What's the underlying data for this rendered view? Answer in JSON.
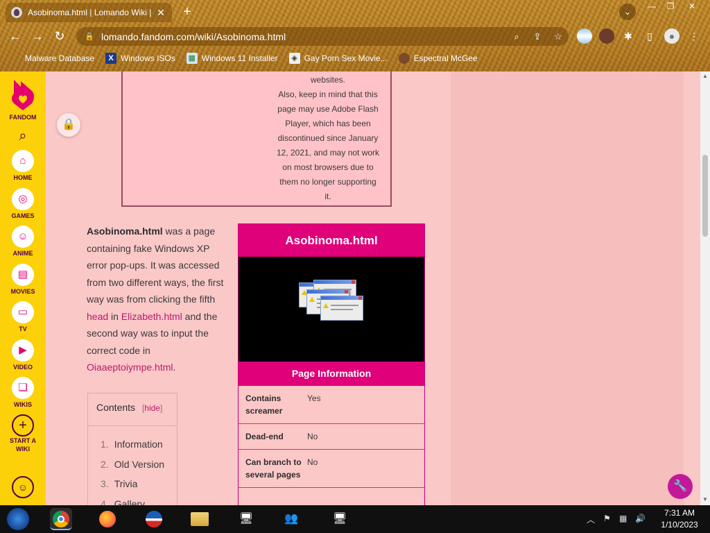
{
  "browser": {
    "tab_title": "Asobinoma.html | Lomando Wiki |",
    "url": "lomando.fandom.com/wiki/Asobinoma.html",
    "bookmarks": [
      {
        "label": "Malware Database",
        "icon": "apple-icon"
      },
      {
        "label": "Windows ISOs",
        "icon": "x-icon"
      },
      {
        "label": "Windows 11 Installer",
        "icon": "image-icon"
      },
      {
        "label": "Gay Porn Sex Movie...",
        "icon": "globe-icon"
      },
      {
        "label": "Espectral McGee",
        "icon": "avatar-icon"
      }
    ]
  },
  "fandom_nav": {
    "logo_label": "FANDOM",
    "items": [
      {
        "label": "HOME",
        "icon": "home-icon"
      },
      {
        "label": "GAMES",
        "icon": "gamepad-icon"
      },
      {
        "label": "ANIME",
        "icon": "anime-icon"
      },
      {
        "label": "MOVIES",
        "icon": "clapper-icon"
      },
      {
        "label": "TV",
        "icon": "tv-icon"
      },
      {
        "label": "VIDEO",
        "icon": "play-icon"
      },
      {
        "label": "WIKIS",
        "icon": "book-icon"
      },
      {
        "label": "START A WIKI",
        "icon": "plus-icon"
      }
    ]
  },
  "warning_box": {
    "lines": [
      "websites.",
      "Also, keep in mind that this",
      "page may use Adobe Flash",
      "Player, which has been",
      "discontinued since January",
      "12, 2021, and may not work",
      "on most browsers due to",
      "them no longer supporting",
      "it."
    ]
  },
  "article": {
    "bold_title": "Asobinoma.html",
    "text1": " was a page containing fake Windows XP error pop-ups. It was accessed from two different ways, the first way was from clicking the fifth ",
    "link_head": "head",
    "text2": " in ",
    "link_elizabeth": "Elizabeth.html",
    "text3": " and the second way was to input the correct code in ",
    "link_code": "Oiaaeptoiympe.html",
    "text4": "."
  },
  "toc": {
    "title": "Contents",
    "hide_open": "[",
    "hide_label": "hide",
    "hide_close": "]",
    "items": [
      {
        "num": "1.",
        "label": "Information"
      },
      {
        "num": "2.",
        "label": "Old Version"
      },
      {
        "num": "3.",
        "label": "Trivia"
      },
      {
        "num": "4.",
        "label": "Gallery"
      }
    ]
  },
  "infobox": {
    "title": "Asobinoma.html",
    "section": "Page Information",
    "rows": [
      {
        "key": "Contains screamer",
        "value": "Yes"
      },
      {
        "key": "Dead-end",
        "value": "No"
      },
      {
        "key": "Can branch to several pages",
        "value": "No"
      }
    ]
  },
  "taskbar": {
    "time": "7:31 AM",
    "date": "1/10/2023"
  }
}
